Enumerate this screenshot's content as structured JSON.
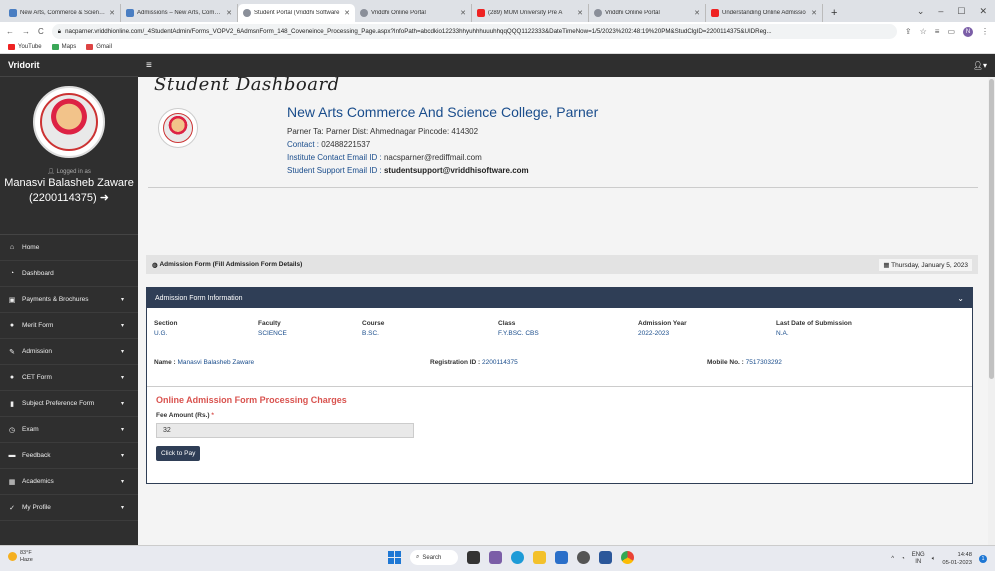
{
  "browser": {
    "tabs": [
      {
        "title": "New Arts, Commerce & Science C",
        "icon": "site-favicon"
      },
      {
        "title": "Admissions – New Arts, Commer",
        "icon": "site-favicon"
      },
      {
        "title": "Student Portal (Vriddhi Software",
        "icon": "globe-icon",
        "active": true
      },
      {
        "title": "Vriddhi Online Portal",
        "icon": "globe-icon"
      },
      {
        "title": "(289) MUM University Pre A",
        "icon": "youtube-icon"
      },
      {
        "title": "Vriddhi Online Portal",
        "icon": "globe-icon"
      },
      {
        "title": "Understanding Online Admissio",
        "icon": "youtube-icon"
      }
    ],
    "new_tab": "+",
    "window_controls": [
      "⌄",
      "–",
      "☐",
      "✕"
    ],
    "url": "nacparner.vriddhionline.com/_4StudentAdmin/Forms_VOPV2_6AdmsnForm_148_Coveneince_Processing_Page.aspx?InfoPath=abcdkio12233hhyuhhhuuuhhqqQQQ1122333&DateTimeNow=1/5/2023%202:48:19%20PM&StudClgID=2200114375&UIDReg...",
    "bookmarks": [
      "YouTube",
      "Maps",
      "Gmail"
    ]
  },
  "app": {
    "brand": "Vridorit",
    "logged_in_label": "Logged in as",
    "user_name": "Manasvi Balasheb Zaware",
    "user_id": "(2200114375) ➜",
    "nav": [
      {
        "label": "Home",
        "icon": "home-icon",
        "glyph": "⌂",
        "caret": false
      },
      {
        "label": "Dashboard",
        "icon": "dashboard-icon",
        "glyph": "◔",
        "caret": false
      },
      {
        "label": "Payments & Brochures",
        "icon": "payments-icon",
        "glyph": "▣",
        "caret": true
      },
      {
        "label": "Merit Form",
        "icon": "merit-icon",
        "glyph": "●",
        "caret": true
      },
      {
        "label": "Admission",
        "icon": "edit-icon",
        "glyph": "✎",
        "caret": true
      },
      {
        "label": "CET Form",
        "icon": "cet-icon",
        "glyph": "●",
        "caret": true
      },
      {
        "label": "Subject Preference Form",
        "icon": "book-icon",
        "glyph": "▮",
        "caret": true
      },
      {
        "label": "Exam",
        "icon": "clock-icon",
        "glyph": "◷",
        "caret": true
      },
      {
        "label": "Feedback",
        "icon": "feedback-icon",
        "glyph": "▬",
        "caret": true
      },
      {
        "label": "Academics",
        "icon": "grid-icon",
        "glyph": "▦",
        "caret": true
      },
      {
        "label": "My Profile",
        "icon": "wrench-icon",
        "glyph": "✓",
        "caret": true
      }
    ]
  },
  "dashboard_title": "Student Dashboard",
  "college": {
    "name": "New Arts Commerce And Science College, Parner",
    "address": "Parner Ta: Parner Dist: Ahmednagar Pincode: 414302",
    "contact_label": "Contact :",
    "contact": "02488221537",
    "inst_email_label": "Institute Contact Email ID :",
    "inst_email": "nacsparner@rediffmail.com",
    "support_email_label": "Student Support Email ID :",
    "support_email": "studentsupport@vriddhisoftware.com"
  },
  "form_bar": {
    "title": "Admission Form (Fill Admission Form Details)",
    "date": "Thursday, January 5, 2023"
  },
  "panel": {
    "title": "Admission Form Information",
    "columns": [
      {
        "header": "Section",
        "value": "U.G."
      },
      {
        "header": "Faculty",
        "value": "SCIENCE"
      },
      {
        "header": "Course",
        "value": "B.SC."
      },
      {
        "header": "Class",
        "value": "F.Y.BSC. CBS"
      },
      {
        "header": "Admission Year",
        "value": "2022-2023"
      },
      {
        "header": "Last Date of Submission",
        "value": "N.A."
      }
    ],
    "name_label": "Name :",
    "name_value": "Manasvi Balasheb Zaware",
    "reg_label": "Registration ID :",
    "reg_value": "2200114375",
    "mobile_label": "Mobile No. :",
    "mobile_value": "7517303292",
    "charges_title": "Online Admission Form Processing Charges",
    "fee_label": "Fee Amount (Rs.)",
    "fee_required": "*",
    "fee_value": "32",
    "pay_button": "Click to Pay"
  },
  "taskbar": {
    "temp": "83°F",
    "weather": "Haze",
    "search": "Search",
    "lang1": "ENG",
    "lang2": "IN",
    "time": "14:48",
    "date": "05-01-2023",
    "notifications": "1"
  }
}
